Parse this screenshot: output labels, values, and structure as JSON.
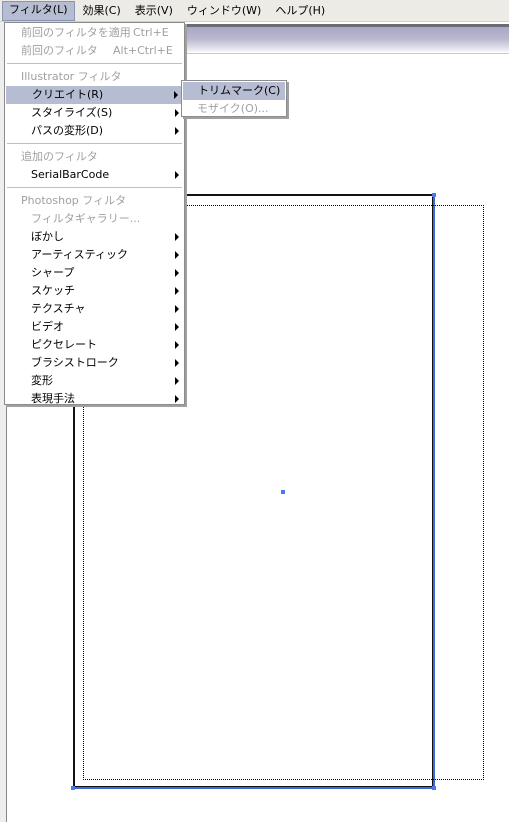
{
  "menubar": {
    "items": [
      {
        "label": "フィルタ(L)",
        "active": true
      },
      {
        "label": "効果(C)"
      },
      {
        "label": "表示(V)"
      },
      {
        "label": "ウィンドウ(W)"
      },
      {
        "label": "ヘルプ(H)"
      }
    ]
  },
  "filter_menu": {
    "apply_last": {
      "label": "前回のフィルタを適用",
      "shortcut": "Ctrl+E",
      "enabled": false
    },
    "last_filter": {
      "label": "前回のフィルタ",
      "shortcut": "Alt+Ctrl+E",
      "enabled": false
    },
    "illustrator_header": "Illustrator フィルタ",
    "illustrator_items": [
      {
        "label": "クリエイト(R)",
        "mnemonic": "R",
        "submenu": true,
        "highlighted": true
      },
      {
        "label": "スタイライズ(S)",
        "mnemonic": "S",
        "submenu": true
      },
      {
        "label": "パスの変形(D)",
        "mnemonic": "D",
        "submenu": true
      }
    ],
    "additional_header": "追加のフィルタ",
    "additional_items": [
      {
        "label": "SerialBarCode",
        "submenu": true
      }
    ],
    "photoshop_header": "Photoshop フィルタ",
    "filter_gallery": {
      "label": "フィルタギャラリー...",
      "enabled": false
    },
    "photoshop_items": [
      {
        "label": "ぼかし",
        "submenu": true
      },
      {
        "label": "アーティスティック",
        "submenu": true
      },
      {
        "label": "シャープ",
        "submenu": true
      },
      {
        "label": "スケッチ",
        "submenu": true
      },
      {
        "label": "テクスチャ",
        "submenu": true
      },
      {
        "label": "ビデオ",
        "submenu": true
      },
      {
        "label": "ピクセレート",
        "submenu": true
      },
      {
        "label": "ブラシストローク",
        "submenu": true
      },
      {
        "label": "変形",
        "submenu": true
      },
      {
        "label": "表現手法",
        "submenu": true
      }
    ]
  },
  "create_submenu": {
    "items": [
      {
        "label": "トリムマーク(C)",
        "highlighted": true,
        "enabled": true
      },
      {
        "label": "モザイク(O)...",
        "enabled": false
      }
    ]
  },
  "colors": {
    "highlight": "#b6bdd2",
    "selection": "#4d78e8",
    "disabled_text": "#a0a0a0"
  }
}
